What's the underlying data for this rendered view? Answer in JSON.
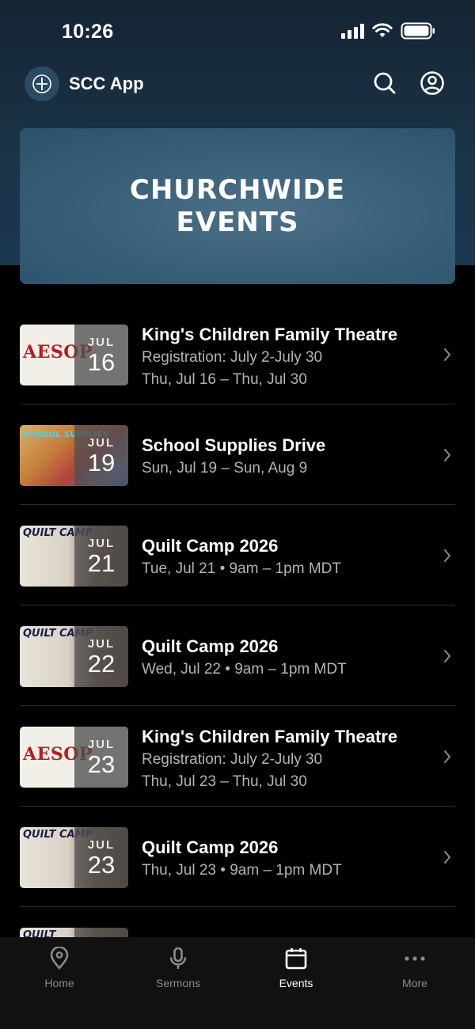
{
  "status_bar": {
    "time": "10:26"
  },
  "app": {
    "title": "SCC App"
  },
  "banner": {
    "line1": "CHURCHWIDE",
    "line2": "EVENTS"
  },
  "events": [
    {
      "title": "King's Children Family Theatre",
      "subtitle": "Registration: July 2-July 30",
      "dates": "Thu, Jul 16 – Thu, Jul 30",
      "month": "JUL",
      "day": "16",
      "thumb": "aesop",
      "thumb_text": "AESOP"
    },
    {
      "title": "School Supplies Drive",
      "subtitle": "",
      "dates": "Sun, Jul 19 – Sun, Aug 9",
      "month": "JUL",
      "day": "19",
      "thumb": "supplies",
      "thumb_text": "SCHOOL SUPPLIES"
    },
    {
      "title": "Quilt Camp 2026",
      "subtitle": "",
      "dates": "Tue, Jul 21 • 9am – 1pm MDT",
      "month": "JUL",
      "day": "21",
      "thumb": "quilt",
      "thumb_text": "QUILT CAMP"
    },
    {
      "title": "Quilt Camp 2026",
      "subtitle": "",
      "dates": "Wed, Jul 22 • 9am – 1pm MDT",
      "month": "JUL",
      "day": "22",
      "thumb": "quilt",
      "thumb_text": "QUILT CAMP"
    },
    {
      "title": "King's Children Family Theatre",
      "subtitle": "Registration: July 2-July 30",
      "dates": "Thu, Jul 23 – Thu, Jul 30",
      "month": "JUL",
      "day": "23",
      "thumb": "aesop",
      "thumb_text": "AESOP"
    },
    {
      "title": "Quilt Camp 2026",
      "subtitle": "",
      "dates": "Thu, Jul 23 • 9am – 1pm MDT",
      "month": "JUL",
      "day": "23",
      "thumb": "quilt",
      "thumb_text": "QUILT CAMP"
    },
    {
      "title": "",
      "subtitle": "",
      "dates": "",
      "month": "",
      "day": "",
      "thumb": "quilt",
      "thumb_text": "QUILT"
    }
  ],
  "tabs": [
    {
      "label": "Home",
      "icon": "map-pin-icon",
      "active": false
    },
    {
      "label": "Sermons",
      "icon": "microphone-icon",
      "active": false
    },
    {
      "label": "Events",
      "icon": "calendar-icon",
      "active": true
    },
    {
      "label": "More",
      "icon": "more-dots-icon",
      "active": false
    }
  ]
}
